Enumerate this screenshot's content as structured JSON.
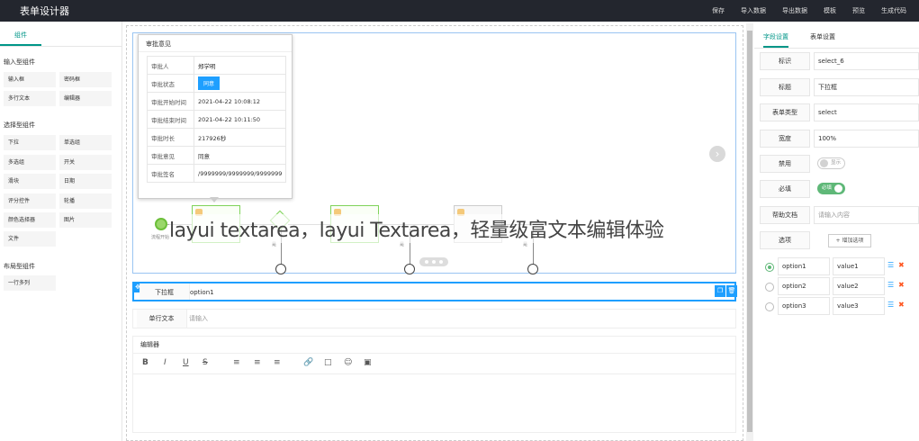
{
  "app": {
    "title": "表单设计器"
  },
  "topmenu": [
    "保存",
    "导入数据",
    "导出数据",
    "模板",
    "预览",
    "生成代码"
  ],
  "left": {
    "tab": "组件",
    "groups": [
      {
        "title": "输入型组件",
        "items": [
          "输入框",
          "密码框",
          "多行文本",
          "编辑器"
        ]
      },
      {
        "title": "选择型组件",
        "items": [
          "下拉",
          "单选组",
          "多选组",
          "开关",
          "滑块",
          "日期",
          "评分控件",
          "轮播",
          "颜色选择器",
          "图片",
          "文件"
        ]
      },
      {
        "title": "布局型组件",
        "items": [
          "一行多列"
        ]
      }
    ]
  },
  "popup": {
    "title": "审批意见",
    "rows": [
      {
        "k": "审批人",
        "v": "郑学明"
      },
      {
        "k": "审批状态",
        "v": "同意"
      },
      {
        "k": "审批开始时间",
        "v": "2021-04-22 10:08:12"
      },
      {
        "k": "审批结束时间",
        "v": "2021-04-22 10:11:50"
      },
      {
        "k": "审批时长",
        "v": "217926秒"
      },
      {
        "k": "审批意见",
        "v": "同意"
      },
      {
        "k": "审批签名",
        "v": "/9999999/9999999/9999999"
      }
    ]
  },
  "flow": {
    "start_label": "流程开始",
    "branch_label": "是"
  },
  "watermark": "layui textarea，layui Textarea，轻量级富文本编辑体验",
  "form": {
    "select": {
      "label": "下拉框",
      "value": "option1"
    },
    "input": {
      "label": "单行文本",
      "placeholder": "请输入"
    },
    "editor": {
      "label": "编辑器",
      "tools": [
        "B",
        "I",
        "U",
        "S",
        "≡",
        "≡",
        "≡",
        "🔗",
        "□",
        "☺",
        "▣"
      ]
    }
  },
  "right": {
    "tabs": [
      "字段设置",
      "表单设置"
    ],
    "props": [
      {
        "label": "标识",
        "value": "select_6"
      },
      {
        "label": "标题",
        "value": "下拉框"
      },
      {
        "label": "表单类型",
        "value": "select"
      },
      {
        "label": "宽度",
        "value": "100%"
      },
      {
        "label": "禁用",
        "value": "显示"
      },
      {
        "label": "必填",
        "value": "必填"
      },
      {
        "label": "帮助文档",
        "placeholder": "请输入内容"
      },
      {
        "label": "选项",
        "value": "+ 增加选项"
      }
    ],
    "options": [
      {
        "label": "option1",
        "value": "value1",
        "checked": true
      },
      {
        "label": "option2",
        "value": "value2",
        "checked": false
      },
      {
        "label": "option3",
        "value": "value3",
        "checked": false
      }
    ]
  },
  "colors": {
    "topbar": "#23262e",
    "accent": "#009688",
    "blue": "#1e9fff",
    "green": "#5fb878",
    "danger": "#ff5722"
  }
}
